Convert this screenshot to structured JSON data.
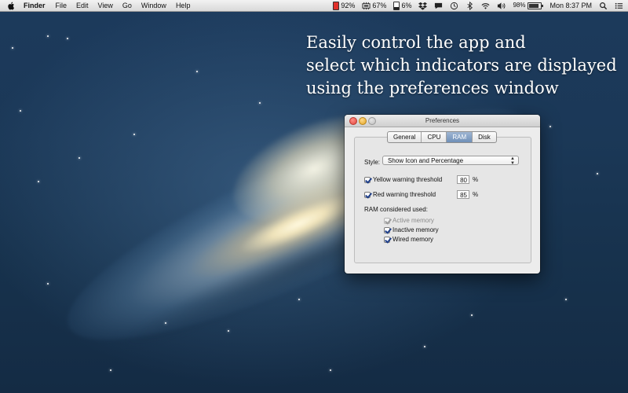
{
  "menubar": {
    "app_name": "Finder",
    "menus": [
      "File",
      "Edit",
      "View",
      "Go",
      "Window",
      "Help"
    ],
    "status": {
      "indicator_1": "92%",
      "indicator_2": "67%",
      "indicator_3": "6%",
      "battery": "98%",
      "clock": "Mon 8:37 PM"
    }
  },
  "caption": {
    "line1": "Easily control the app and",
    "line2": "select which indicators are displayed",
    "line3": "using the preferences window"
  },
  "window": {
    "title": "Preferences",
    "tabs": [
      "General",
      "CPU",
      "RAM",
      "Disk"
    ],
    "active_tab": "RAM",
    "style_label": "Style:",
    "style_value": "Show Icon and Percentage",
    "yellow_label": "Yellow warning threshold",
    "yellow_value": "80",
    "red_label": "Red warning threshold",
    "red_value": "85",
    "percent_sign": "%",
    "ram_section_label": "RAM considered used:",
    "memory_options": [
      {
        "label": "Active memory",
        "checked": true,
        "enabled": false
      },
      {
        "label": "Inactive memory",
        "checked": true,
        "enabled": true
      },
      {
        "label": "Wired memory",
        "checked": true,
        "enabled": true
      }
    ]
  },
  "colors": {
    "indicator_red": "#e0302a",
    "accent": "#2a57c9"
  }
}
